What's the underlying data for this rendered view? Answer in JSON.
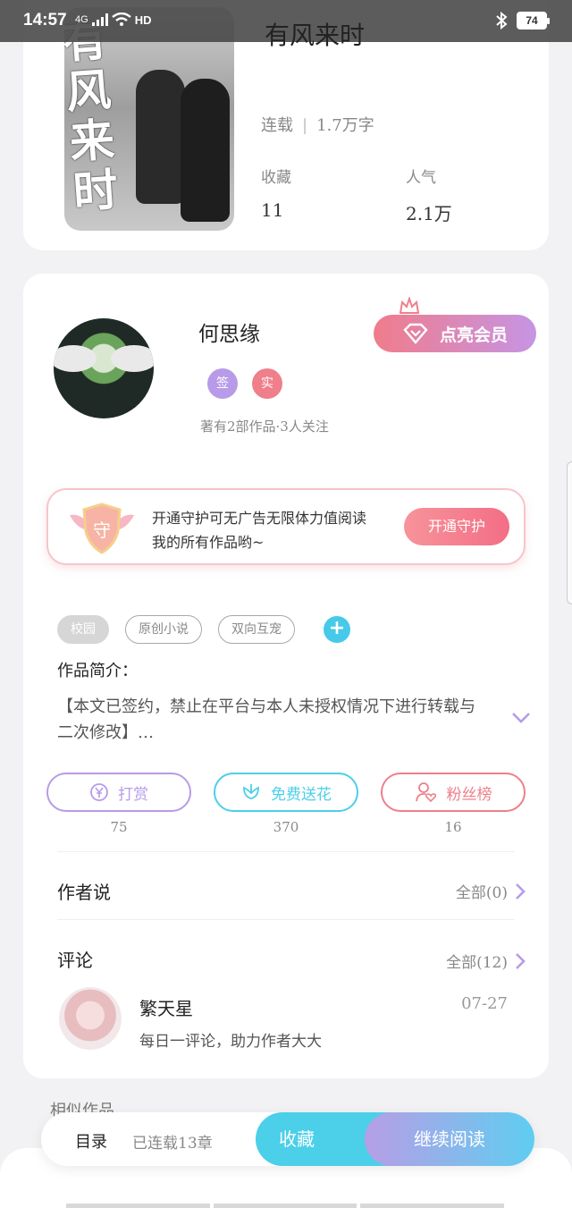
{
  "status": {
    "time": "14:57",
    "network": "4G",
    "hd": "HD",
    "battery": "74"
  },
  "book": {
    "cover_title": "有风来时",
    "title": "有风来时",
    "status": "连载",
    "word_count": "1.7万字",
    "collect_label": "收藏",
    "collect_value": "11",
    "popularity_label": "人气",
    "popularity_value": "2.1万"
  },
  "author": {
    "name": "何思缘",
    "badge_signed": "签",
    "badge_real": "实",
    "stats": "著有2部作品·3人关注",
    "vip_label": "点亮会员"
  },
  "guard": {
    "shield_char": "守",
    "text": "开通守护可无广告无限体力值阅读我的所有作品哟~",
    "button": "开通守护"
  },
  "tags": [
    "校园",
    "原创小说",
    "双向互宠"
  ],
  "tag_add": "+",
  "intro": {
    "label": "作品简介：",
    "text": "【本文已签约，禁止在平台与本人未授权情况下进行转载与二次修改】…"
  },
  "actions": [
    {
      "label": "打赏",
      "count": "75",
      "color": "#b79be8",
      "icon": "yuan-icon"
    },
    {
      "label": "免费送花",
      "count": "370",
      "color": "#4ccfe9",
      "icon": "flower-icon"
    },
    {
      "label": "粉丝榜",
      "count": "16",
      "color": "#ef7f8a",
      "icon": "fans-icon"
    }
  ],
  "author_says": {
    "title": "作者说",
    "more": "全部(0)"
  },
  "comments": {
    "title": "评论",
    "more": "全部(12)",
    "items": [
      {
        "user": "繁天星",
        "date": "07-27",
        "text": "每日一评论，助力作者大大"
      }
    ]
  },
  "similar_label": "相似作品",
  "bottom_bar": {
    "toc": "目录",
    "chapters": "已连载13章",
    "favorite": "收藏",
    "continue": "继续阅读"
  }
}
